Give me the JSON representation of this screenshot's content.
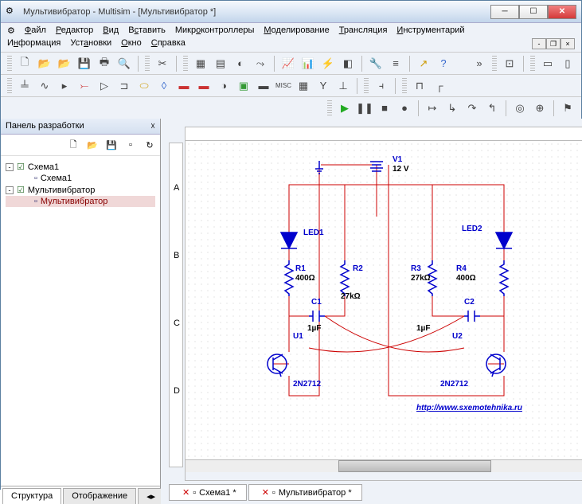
{
  "window": {
    "title": "Мультивибратор - Multisim - [Мультивибратор *]"
  },
  "menu": {
    "file": "Файл",
    "edit": "Редактор",
    "view": "Вид",
    "insert": "Вставить",
    "mcu": "Микроконтроллеры",
    "simulate": "Моделирование",
    "transfer": "Трансляция",
    "tools": "Инструментарий",
    "reports": "Информация",
    "options": "Установки",
    "window": "Окно",
    "help": "Справка"
  },
  "sidebar": {
    "title": "Панель разработки",
    "tree": {
      "root1": "Схема1",
      "root1_child": "Схема1",
      "root2": "Мультивибратор",
      "root2_child": "Мультивибратор"
    },
    "tabs": {
      "structure": "Структура",
      "display": "Отображение"
    }
  },
  "canvas_tabs": {
    "tab1": "Схема1 *",
    "tab2": "Мультивибратор *"
  },
  "circuit": {
    "v1_name": "V1",
    "v1_val": "12 V",
    "led1": "LED1",
    "led2": "LED2",
    "r1_name": "R1",
    "r1_val": "400Ω",
    "r2_name": "R2",
    "r2_val": "27kΩ",
    "r3_name": "R3",
    "r3_val": "27kΩ",
    "r4_name": "R4",
    "r4_val": "400Ω",
    "c1_name": "C1",
    "c1_val": "1µF",
    "c2_name": "C2",
    "c2_val": "1µF",
    "u1": "U1",
    "u2": "U2",
    "q_model": "2N2712",
    "url": "http://www.sxemotehnika.ru"
  }
}
